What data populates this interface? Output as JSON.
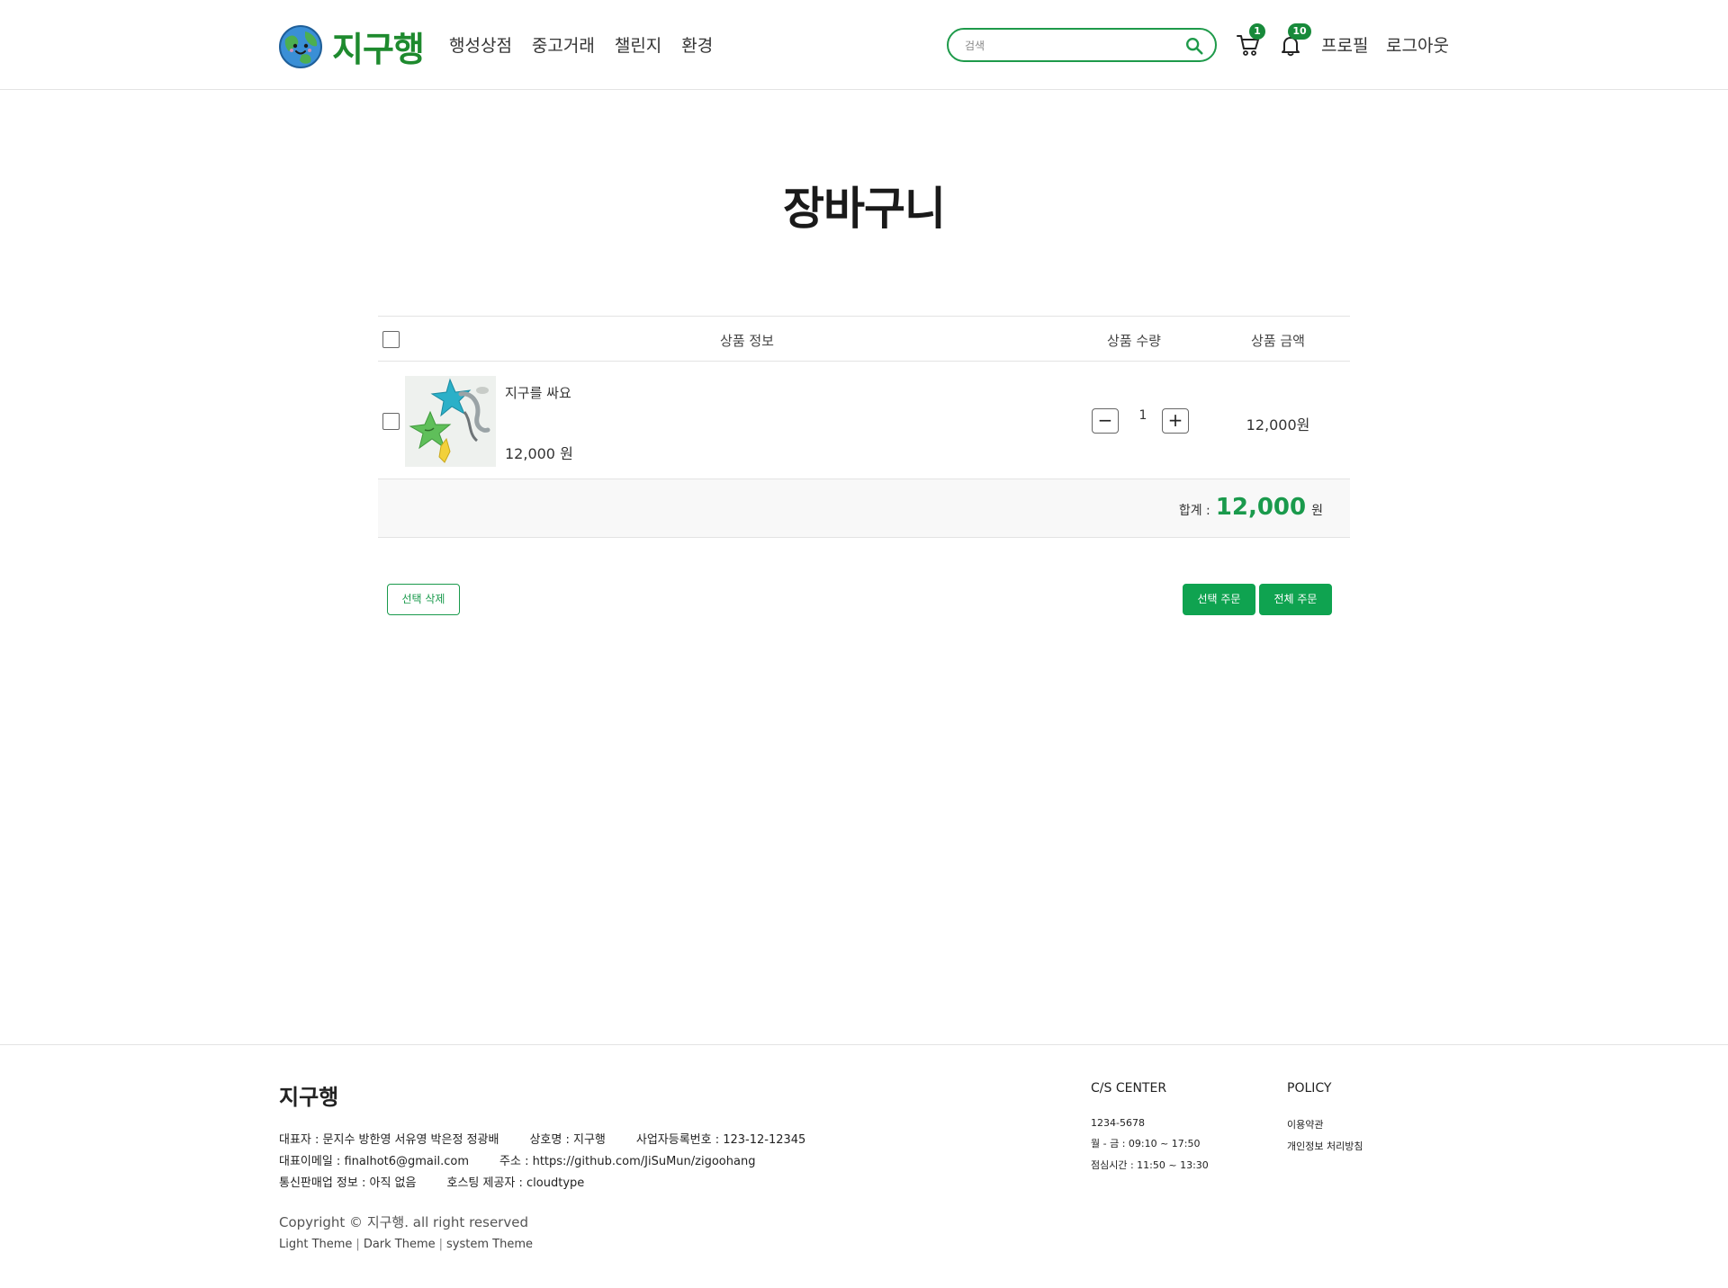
{
  "header": {
    "logo_text": "지구행",
    "nav": [
      "행성상점",
      "중고거래",
      "챌린지",
      "환경"
    ],
    "search_placeholder": "검색",
    "cart_count": "1",
    "notification_count": "10",
    "profile_label": "프로필",
    "logout_label": "로그아웃",
    "brand_color": "#1e8a2e",
    "accent_color": "#0fa350"
  },
  "cart": {
    "title": "장바구니",
    "columns": {
      "info": "상품 정보",
      "qty": "상품 수량",
      "price": "상품 금액"
    },
    "items": [
      {
        "name": "지구를 싸요",
        "unit_price": "12,000 원",
        "quantity": "1",
        "total": "12,000원",
        "thumb_icon": "starfish-toy-image"
      }
    ],
    "total_label": "합계 :",
    "total_amount": "12,000",
    "total_unit": "원",
    "qty_minus": "−",
    "qty_plus": "+",
    "delete_selected": "선택 삭제",
    "order_selected": "선택 주문",
    "order_all": "전체 주문"
  },
  "footer": {
    "brand": "지구행",
    "line1": [
      "대표자 : 문지수 방한영 서유영 박은정 정광배",
      "상호명 : 지구행",
      "사업자등록번호 : 123-12-12345"
    ],
    "line2": [
      "대표이메일 : finalhot6@gmail.com",
      "주소 : https://github.com/JiSuMun/zigoohang"
    ],
    "line3": [
      "통신판매업 정보 : 아직 없음",
      "호스팅 제공자 : cloudtype"
    ],
    "copyright": "Copyright © 지구행. all right reserved",
    "themes": [
      "Light Theme",
      "Dark Theme",
      "system Theme"
    ],
    "cs": {
      "title": "C/S CENTER",
      "items": [
        "1234-5678",
        "월 - 금 : 09:10 ~ 17:50",
        "점심시간 : 11:50 ~ 13:30"
      ]
    },
    "policy": {
      "title": "POLICY",
      "items": [
        "이용약관",
        "개인정보 처리방침"
      ]
    }
  }
}
